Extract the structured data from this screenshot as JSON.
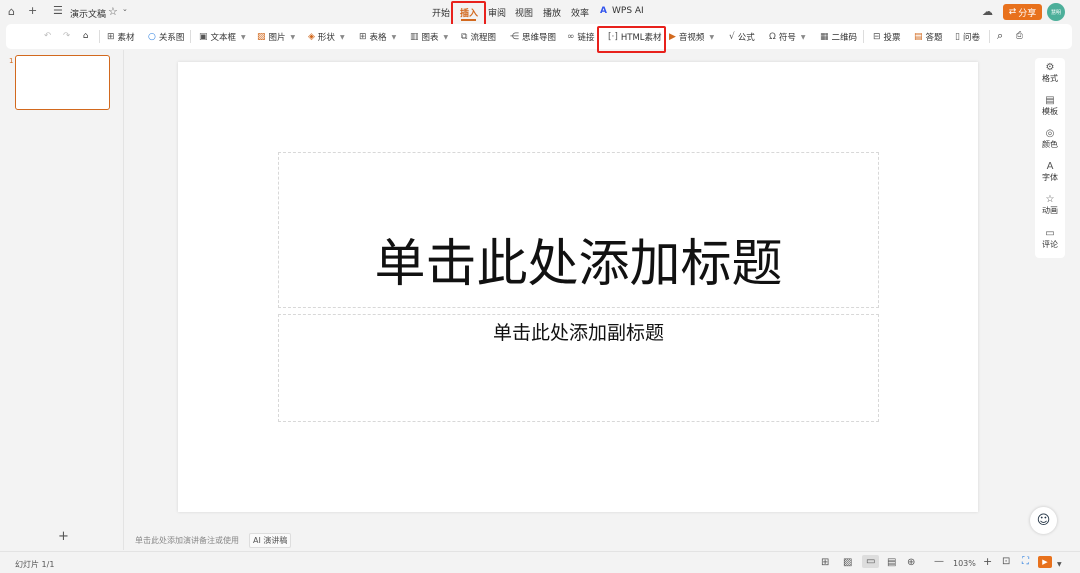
{
  "titlebar": {
    "doc_name": "演示文稿",
    "menus": [
      "开始",
      "插入",
      "审阅",
      "视图",
      "播放",
      "效率",
      "WPS AI"
    ],
    "active_menu": "插入",
    "share": "分享",
    "avatar": "慧明"
  },
  "toolbar": {
    "items": [
      "素材",
      "关系图",
      "文本框",
      "图片",
      "形状",
      "表格",
      "图表",
      "流程图",
      "思维导图",
      "链接",
      "HTML素材",
      "音视频",
      "公式",
      "符号",
      "二维码",
      "投票",
      "答题",
      "问卷"
    ]
  },
  "slide_panel": {
    "slide_number": "1",
    "add": "+"
  },
  "slide": {
    "title_placeholder": "单击此处添加标题",
    "subtitle_placeholder": "单击此处添加副标题"
  },
  "notes": {
    "placeholder": "单击此处添加演讲备注或使用",
    "ai_button": "AI 演讲稿"
  },
  "right_panel": [
    {
      "label": "格式",
      "icon": "⚙"
    },
    {
      "label": "模板",
      "icon": "▤"
    },
    {
      "label": "颜色",
      "icon": "◎"
    },
    {
      "label": "字体",
      "icon": "A"
    },
    {
      "label": "动画",
      "icon": "☆"
    },
    {
      "label": "评论",
      "icon": "▭"
    }
  ],
  "statusbar": {
    "slide_info": "幻灯片 1/1",
    "zoom": "103%"
  },
  "colors": {
    "accent": "#e8711c",
    "highlight": "#e8211c"
  }
}
